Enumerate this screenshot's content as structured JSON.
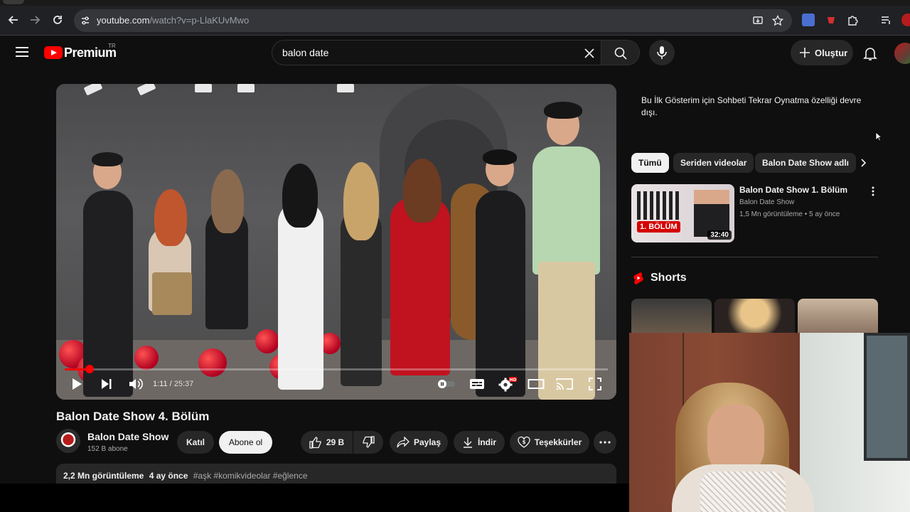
{
  "browser": {
    "url_host": "youtube.com",
    "url_path": "/watch?v=p-LlaKUvMwo"
  },
  "header": {
    "logo_text": "Premium",
    "country_code": "TR",
    "search_query": "balon date",
    "create_label": "Oluştur"
  },
  "player": {
    "current_time": "1:11",
    "duration": "25:37",
    "time_separator": " / ",
    "progress_fraction": 0.046
  },
  "video": {
    "title": "Balon Date Show 4. Bölüm",
    "channel_name": "Balon Date Show",
    "subscribers": "152 B abone",
    "join_label": "Katıl",
    "subscribe_label": "Abone ol",
    "like_count": "29 B",
    "share_label": "Paylaş",
    "download_label": "İndir",
    "thanks_label": "Teşekkürler",
    "views": "2,2 Mn görüntüleme",
    "age": "4 ay önce",
    "hashtags": "#aşk #komikvideolar #eğlence"
  },
  "sidebar": {
    "chat_notice": "Bu İlk Gösterim için Sohbeti Tekrar Oynatma özelliği devre dışı.",
    "chips": [
      "Tümü",
      "Seriden videolar",
      "Balon Date Show adlı"
    ],
    "recommendation": {
      "title": "Balon Date Show 1. Bölüm",
      "channel": "Balon Date Show",
      "meta": "1,5 Mn görüntüleme • 5 ay önce",
      "duration": "32:40",
      "thumb_badge": "1. BÖLÜM"
    },
    "shorts_title": "Shorts"
  },
  "colors": {
    "brand_red": "#ff0000",
    "background": "#0f0f0f",
    "chip_bg": "#272727"
  }
}
